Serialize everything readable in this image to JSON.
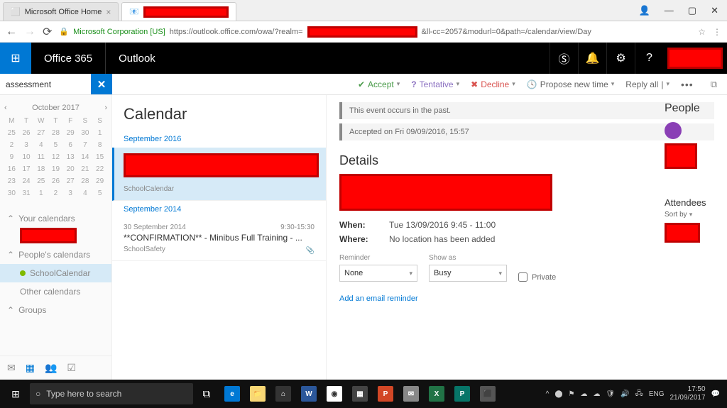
{
  "browser": {
    "tabs": [
      {
        "icon": "⬜",
        "label": "Microsoft Office Home"
      },
      {
        "icon": "📧",
        "label": ""
      }
    ],
    "secure_label": "Microsoft Corporation [US]",
    "url_prefix": "https://outlook.office.com/owa/?realm=",
    "url_suffix": "&ll-cc=2057&modurl=0&path=/calendar/view/Day"
  },
  "header": {
    "brand": "Office 365",
    "app": "Outlook"
  },
  "search": {
    "value": "assessment"
  },
  "actions": {
    "accept": "Accept",
    "tentative": "Tentative",
    "decline": "Decline",
    "propose": "Propose new time",
    "reply": "Reply all"
  },
  "minical": {
    "month": "October 2017",
    "dow": [
      "M",
      "T",
      "W",
      "T",
      "F",
      "S",
      "S"
    ],
    "rows": [
      [
        "25",
        "26",
        "27",
        "28",
        "29",
        "30",
        "1"
      ],
      [
        "2",
        "3",
        "4",
        "5",
        "6",
        "7",
        "8"
      ],
      [
        "9",
        "10",
        "11",
        "12",
        "13",
        "14",
        "15"
      ],
      [
        "16",
        "17",
        "18",
        "19",
        "20",
        "21",
        "22"
      ],
      [
        "23",
        "24",
        "25",
        "26",
        "27",
        "28",
        "29"
      ],
      [
        "30",
        "31",
        "1",
        "2",
        "3",
        "4",
        "5"
      ]
    ]
  },
  "sidebar": {
    "your_calendars": "Your calendars",
    "peoples_calendars": "People's calendars",
    "school_cal": "SchoolCalendar",
    "other_calendars": "Other calendars",
    "groups": "Groups"
  },
  "mid": {
    "title": "Calendar",
    "groups": [
      {
        "label": "September 2016",
        "items": [
          {
            "date": "",
            "time": "",
            "title": "",
            "owner": "SchoolCalendar",
            "selected": true,
            "redacted": true
          }
        ]
      },
      {
        "label": "September 2014",
        "items": [
          {
            "date": "30 September 2014",
            "time": "9:30-15:30",
            "title": "**CONFIRMATION** - Minibus Full Training - ...",
            "owner": "SchoolSafety",
            "selected": false
          }
        ]
      }
    ]
  },
  "detail": {
    "notice1": "This event occurs in the past.",
    "notice2": "Accepted on Fri 09/09/2016, 15:57",
    "section": "Details",
    "when_k": "When:",
    "when_v": "Tue 13/09/2016 9:45 - 11:00",
    "where_k": "Where:",
    "where_v": "No location has been added",
    "reminder_label": "Reminder",
    "reminder_value": "None",
    "showas_label": "Show as",
    "showas_value": "Busy",
    "private_label": "Private",
    "add_reminder": "Add an email reminder",
    "people": "People",
    "attendees": "Attendees",
    "sortby": "Sort by"
  },
  "taskbar": {
    "search_placeholder": "Type here to search",
    "time": "17:50",
    "date": "21/09/2017",
    "lang": "ENG"
  }
}
